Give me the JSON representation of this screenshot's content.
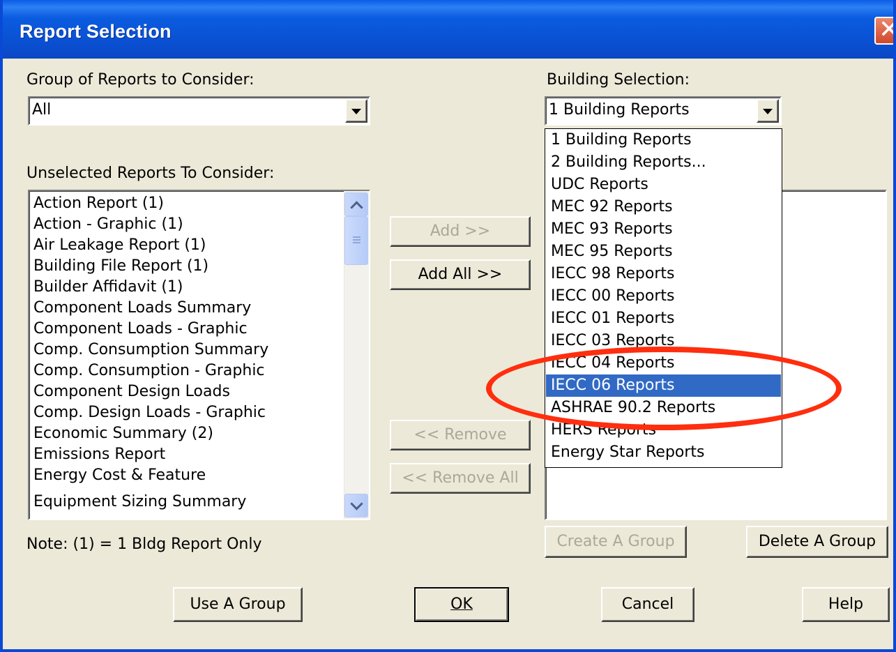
{
  "window": {
    "title": "Report Selection",
    "close_glyph": "✕"
  },
  "group": {
    "label": "Group of Reports to Consider:",
    "value": "All"
  },
  "building": {
    "label": "Building Selection:",
    "value": "1 Building Reports",
    "options": [
      "1 Building Reports",
      "2 Building Reports...",
      "UDC Reports",
      "MEC 92 Reports",
      "MEC 93 Reports",
      "MEC 95 Reports",
      "IECC 98 Reports",
      "IECC 00 Reports",
      "IECC 01 Reports",
      "IECC 03 Reports",
      "IECC 04 Reports",
      "IECC 06 Reports",
      "ASHRAE 90.2 Reports",
      "HERS Reports",
      "Energy Star Reports"
    ],
    "highlighted_option": "IECC 06 Reports"
  },
  "unselected": {
    "label": "Unselected Reports To Consider:",
    "items": [
      "Action Report (1)",
      "Action - Graphic (1)",
      "Air Leakage Report (1)",
      "Building File Report (1)",
      "Builder Affidavit (1)",
      "Component Loads Summary",
      "Component Loads - Graphic",
      "Comp. Consumption Summary",
      "Comp. Consumption - Graphic",
      "Component Design Loads",
      "Comp. Design Loads - Graphic",
      "Economic Summary (2)",
      "Emissions Report",
      "Energy Cost & Feature",
      "Equipment Sizing Summary"
    ]
  },
  "note": "Note: (1) = 1 Bldg Report Only",
  "buttons": {
    "add": "Add >>",
    "add_all": "Add All >>",
    "remove": "<< Remove",
    "remove_all": "<< Remove All",
    "create_group": "Create A Group",
    "delete_group": "Delete A Group",
    "use_group": "Use A Group",
    "ok": "OK",
    "cancel": "Cancel",
    "help": "Help"
  },
  "colors": {
    "titlebar": "#0b5ce0",
    "face": "#ece9d8",
    "selection": "#316ac5",
    "annotation": "#ff2e0e"
  }
}
